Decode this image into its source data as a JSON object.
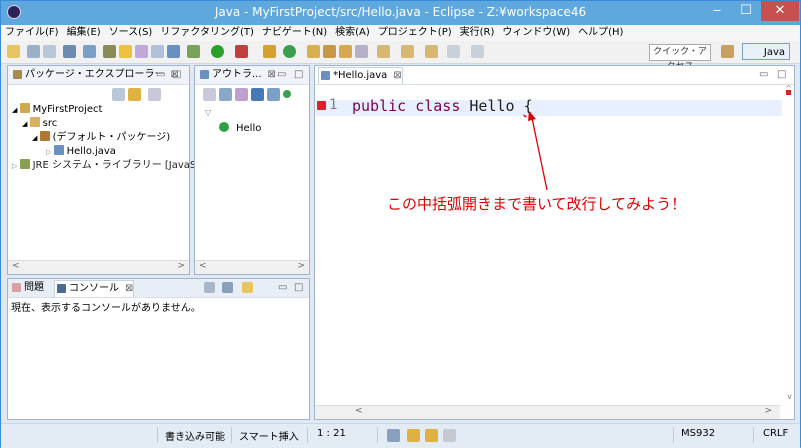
{
  "window": {
    "title": "Java - MyFirstProject/src/Hello.java - Eclipse - Z:¥workspace46",
    "minimize": "‒",
    "maximize": "☐",
    "close": "✕"
  },
  "menu": [
    "ファイル(F)",
    "編集(E)",
    "ソース(S)",
    "リファクタリング(T)",
    "ナビゲート(N)",
    "検索(A)",
    "プロジェクト(P)",
    "実行(R)",
    "ウィンドウ(W)",
    "ヘルプ(H)"
  ],
  "toolbar": {
    "quick_access": "クイック・アクセス",
    "perspective": "Java"
  },
  "package_explorer": {
    "tab": "パッケージ・エクスプローラー",
    "tree": [
      "MyFirstProject",
      "src",
      "(デフォルト・パッケージ)",
      "Hello.java",
      "JRE システム・ライブラリー [JavaSE-"
    ]
  },
  "outline": {
    "tab": "アウトラ...",
    "item": "Hello"
  },
  "editor": {
    "tab": "*Hello.java",
    "line_number": "1",
    "kw1": "public",
    "kw2": "class",
    "classname": "Hello",
    "brace": "{"
  },
  "console": {
    "tab_problems": "問題",
    "tab_console": "コンソール",
    "message": "現在、表示するコンソールがありません。"
  },
  "annotation": "この中括弧開きまで書いて改行してみよう！",
  "status": {
    "writable": "書き込み可能",
    "insert": "スマート挿入",
    "position": "1 : 21",
    "encoding": "MS932",
    "lineend": "CRLF"
  },
  "colors": {
    "title_bar": "#5fa8de",
    "annotation": "#e00000",
    "keyword": "#7f0055"
  }
}
